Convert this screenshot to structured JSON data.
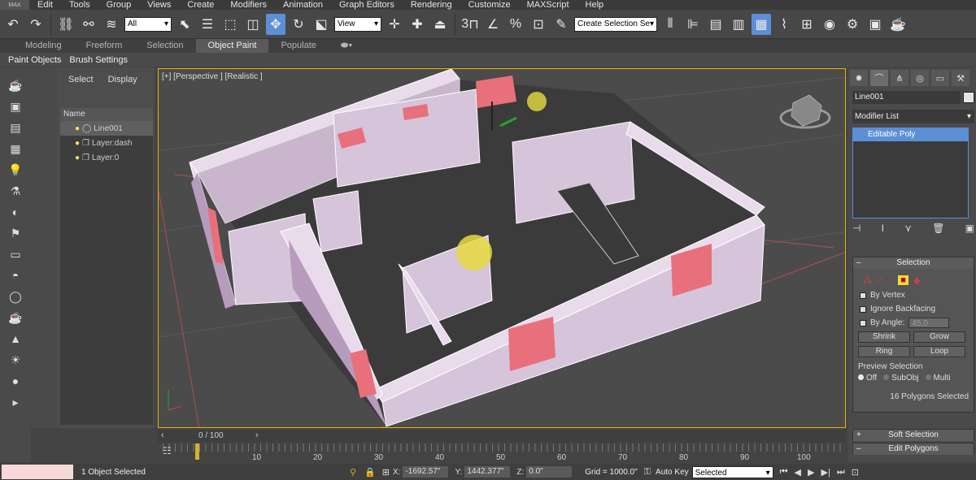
{
  "menu": {
    "logo": "MAX",
    "items": [
      "Edit",
      "Tools",
      "Group",
      "Views",
      "Create",
      "Modifiers",
      "Animation",
      "Graph Editors",
      "Rendering",
      "Customize",
      "MAXScript",
      "Help"
    ]
  },
  "toolbar": {
    "filter_value": "All",
    "ref_coord_value": "View",
    "named_selection_placeholder": "Create Selection Se",
    "snap_label": "3"
  },
  "ribbon": {
    "tabs": [
      "Modeling",
      "Freeform",
      "Selection",
      "Object Paint",
      "Populate"
    ],
    "active_tab": "Object Paint",
    "sub_items": [
      "Paint Objects",
      "Brush Settings"
    ]
  },
  "explorer": {
    "tabs": [
      "Select",
      "Display"
    ],
    "column_header": "Name",
    "rows": [
      "Line001",
      "Layer:dash",
      "Layer:0"
    ]
  },
  "viewport": {
    "label": "[+] [Perspective ] [Realistic ]"
  },
  "command_panel": {
    "object_name": "Line001",
    "modifier_list": "Modifier List",
    "stack_item": "Editable Poly",
    "selection": {
      "title": "Selection",
      "by_vertex": "By Vertex",
      "ignore_backfacing": "Ignore Backfacing",
      "by_angle": "By Angle:",
      "angle_value": "45.0",
      "shrink": "Shrink",
      "grow": "Grow",
      "ring": "Ring",
      "loop": "Loop",
      "preview_title": "Preview Selection",
      "preview_options": [
        "Off",
        "SubObj",
        "Multi"
      ],
      "status": "16 Polygons Selected"
    },
    "soft_selection": "Soft Selection",
    "edit_polygons": "Edit Polygons"
  },
  "time": {
    "slider_label": "0 / 100",
    "ticks": [
      "10",
      "20",
      "30",
      "40",
      "50",
      "60",
      "70",
      "80",
      "90",
      "100"
    ]
  },
  "status": {
    "text": "1 Object Selected",
    "x_label": "X:",
    "x_value": "-1692.57\"",
    "y_label": "Y:",
    "y_value": "1442.377\"",
    "z_label": "Z:",
    "z_value": "0.0\"",
    "grid": "Grid = 1000.0\"",
    "auto_key": "Auto Key",
    "selected": "Selected"
  },
  "colors": {
    "accent": "#5b8fd6",
    "wall": "#d9c7de",
    "selected_poly": "#e8707c",
    "viewport_border": "#e7b400"
  }
}
